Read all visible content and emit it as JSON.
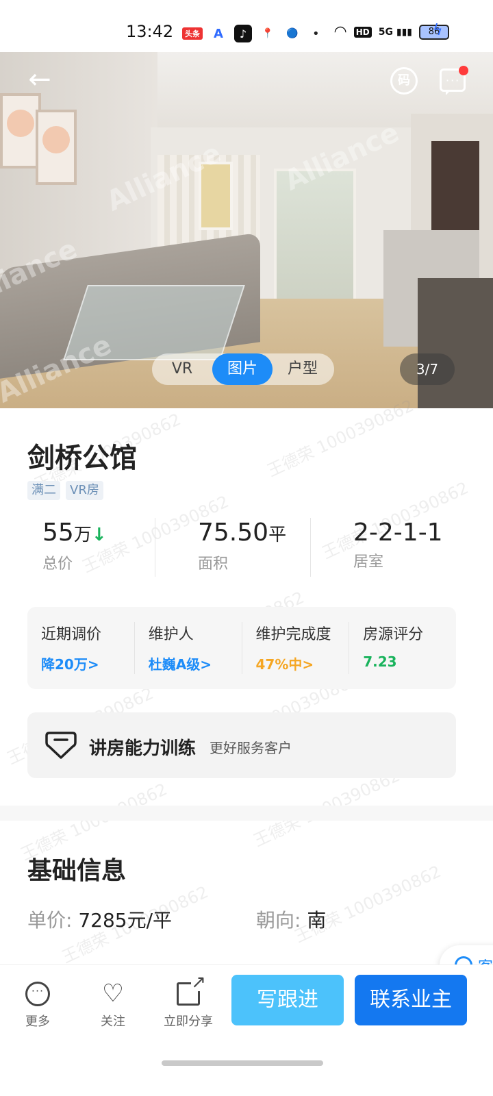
{
  "status_bar": {
    "time": "13:42",
    "apps": [
      "头条",
      "A",
      "♪",
      "📍",
      "🔵"
    ],
    "network": "5G",
    "hd": "HD",
    "battery": "86"
  },
  "hero": {
    "watermark": "Alliance",
    "media_tabs": [
      {
        "label": "VR",
        "active": false
      },
      {
        "label": "图片",
        "active": true
      },
      {
        "label": "户型",
        "active": false
      }
    ],
    "page_counter": "3/7",
    "qr_label": "码"
  },
  "listing": {
    "title": "剑桥公馆",
    "tags": [
      "满二",
      "VR房"
    ],
    "stats": [
      {
        "value": "55",
        "unit": "万",
        "label": "总价"
      },
      {
        "value": "75.50",
        "unit": "平",
        "label": "面积"
      },
      {
        "value": "2-2-1-1",
        "unit": "",
        "label": "居室"
      }
    ]
  },
  "info_card": [
    {
      "label": "近期调价",
      "value": "降20万>",
      "color": "#1d8cf8"
    },
    {
      "label": "维护人",
      "value": "杜巍A级>",
      "color": "#1d8cf8"
    },
    {
      "label": "维护完成度",
      "value": "47%中>",
      "color": "#f5a623"
    },
    {
      "label": "房源评分",
      "value": "7.23",
      "color": "#19b35c"
    }
  ],
  "training": {
    "title": "讲房能力训练",
    "subtitle": "更好服务客户"
  },
  "basic_info": {
    "title": "基础信息",
    "unit_price_key": "单价:",
    "unit_price_value": "7285元/平",
    "orientation_key": "朝向:",
    "orientation_value": "南"
  },
  "content_watermark": "王德荣 1000390862",
  "service_label": "客",
  "bottom_bar": {
    "more_label": "更多",
    "follow_label": "关注",
    "share_label": "立即分享",
    "write_followup": "写跟进",
    "contact_owner": "联系业主"
  },
  "colors": {
    "accent": "#1d8cf8",
    "follow_button": "#4cc2fb",
    "contact_button": "#1478f0",
    "price_drop": "#19b35c"
  }
}
